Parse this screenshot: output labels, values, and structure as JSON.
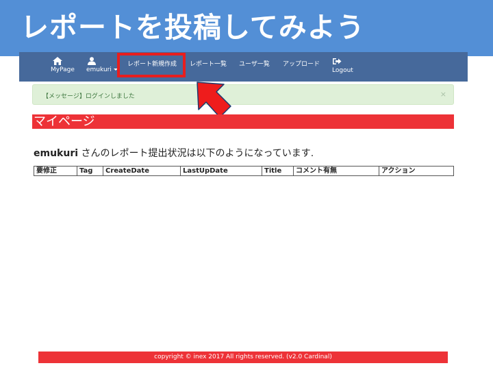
{
  "slide": {
    "title": "レポートを投稿してみよう"
  },
  "navbar": {
    "items": [
      {
        "label": "MyPage",
        "icon": "home-icon"
      },
      {
        "label": "emukuri",
        "icon": "user-icon"
      },
      {
        "label": "レポート新規作成"
      },
      {
        "label": "レポート一覧"
      },
      {
        "label": "ユーザ一覧"
      },
      {
        "label": "アップロード"
      },
      {
        "label": "Logout",
        "icon": "logout-icon"
      }
    ]
  },
  "flash": {
    "message": "【メッセージ】ログインしました",
    "close": "×"
  },
  "page": {
    "heading": "マイページ",
    "user": "emukuri",
    "status_text": " さんのレポート提出状況は以下のようになっています."
  },
  "table": {
    "headers": [
      "要修正",
      "Tag",
      "CreateDate",
      "LastUpDate",
      "Title",
      "コメント有無",
      "アクション"
    ]
  },
  "footer": {
    "text": "copyright © inex 2017 All rights reserved. (v2.0 Cardinal)"
  },
  "colors": {
    "slide_header": "#538fd6",
    "navbar": "#46699b",
    "accent_red": "#ed3237",
    "highlight_red": "#e81e1e",
    "flash_bg": "#dff0d8",
    "flash_text": "#3c763d"
  }
}
